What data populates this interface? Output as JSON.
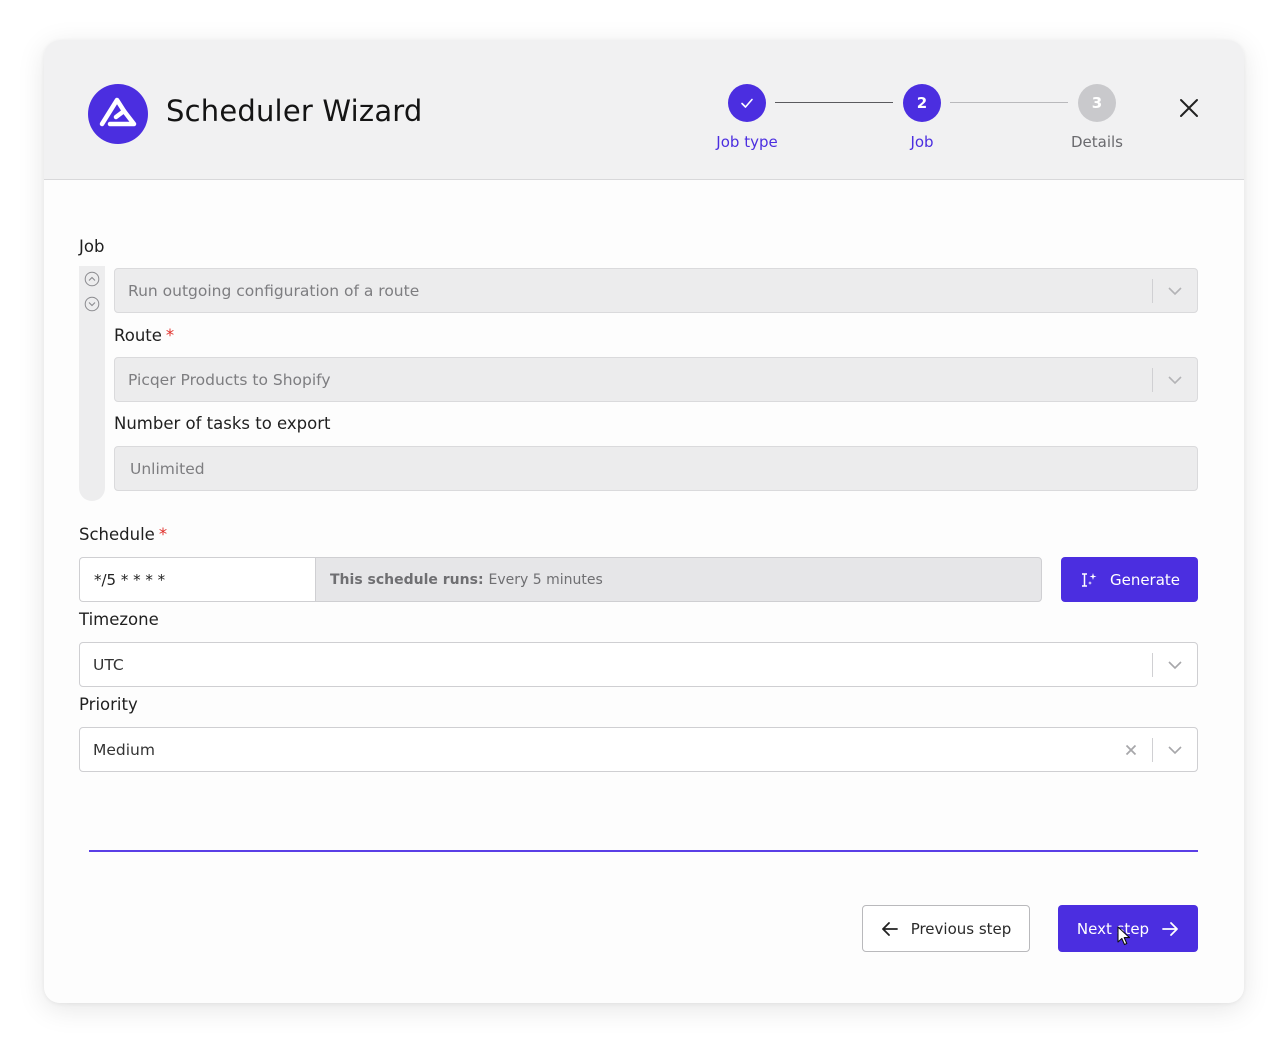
{
  "header": {
    "title": "Scheduler Wizard",
    "steps": [
      {
        "number": "✓",
        "label": "Job type",
        "state": "done"
      },
      {
        "number": "2",
        "label": "Job",
        "state": "current"
      },
      {
        "number": "3",
        "label": "Details",
        "state": "upcoming"
      }
    ]
  },
  "form": {
    "job": {
      "label": "Job",
      "value": "Run outgoing configuration of a route"
    },
    "route": {
      "label": "Route",
      "required_mark": "*",
      "value": "Picqer Products to Shopify"
    },
    "tasks": {
      "label": "Number of tasks to export",
      "value": "Unlimited"
    },
    "schedule": {
      "label": "Schedule",
      "required_mark": "*",
      "cron_value": "*/5 * * * *",
      "runs_label": "This schedule runs:",
      "runs_value": "Every 5 minutes",
      "generate_label": "Generate"
    },
    "timezone": {
      "label": "Timezone",
      "value": "UTC"
    },
    "priority": {
      "label": "Priority",
      "value": "Medium"
    }
  },
  "footer": {
    "previous_label": "Previous step",
    "next_label": "Next step"
  },
  "colors": {
    "accent": "#4b2ee0",
    "required": "#e0302b",
    "inactive_step": "#c9c9cc"
  },
  "icons": {
    "logo": "brand-logo-icon",
    "close": "close-icon",
    "chevron": "chevron-down-icon",
    "clear": "clear-icon",
    "generate": "text-cursor-sparkle-icon",
    "arrow_left": "arrow-left-icon",
    "arrow_right": "arrow-right-icon"
  }
}
